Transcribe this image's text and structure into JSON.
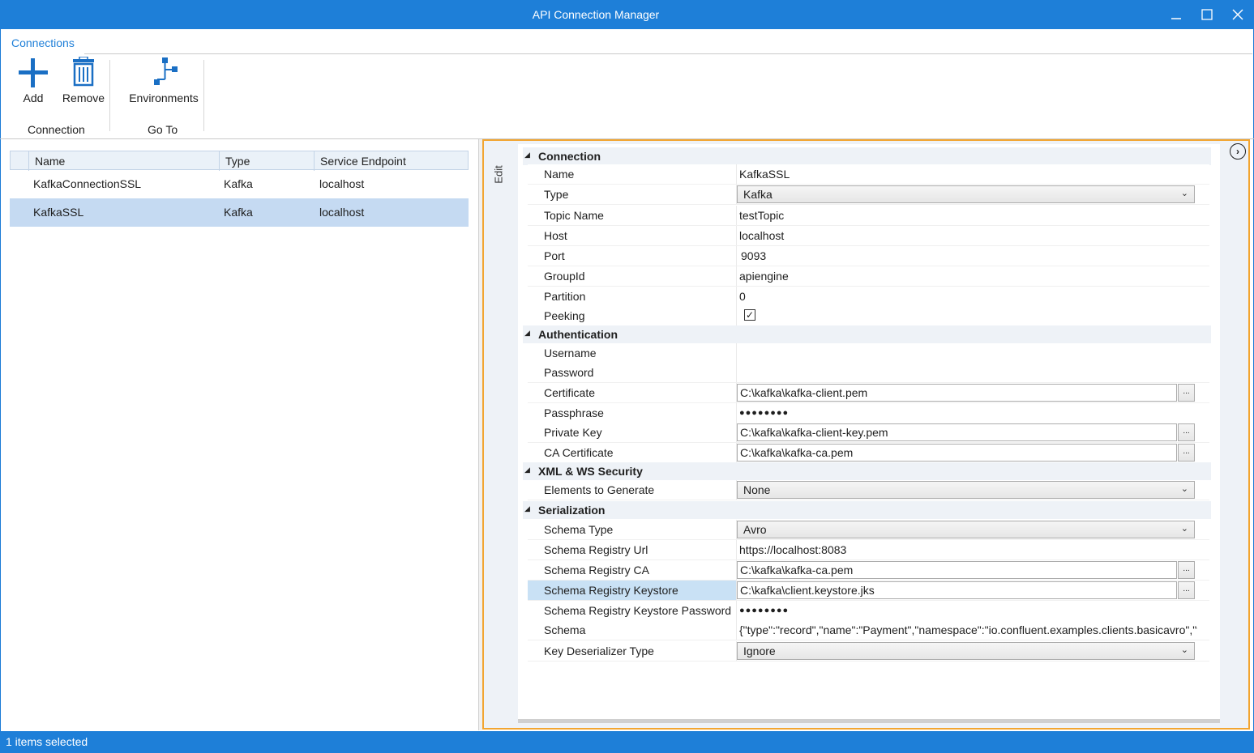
{
  "window": {
    "title": "API Connection Manager",
    "controls": {
      "minimize": "–",
      "maximize": "☐",
      "close": "✕"
    }
  },
  "ribbon": {
    "tab": "Connections",
    "groups": [
      {
        "label": "Connection",
        "buttons": [
          {
            "label": "Add",
            "icon": "plus-icon"
          },
          {
            "label": "Remove",
            "icon": "trash-icon"
          }
        ]
      },
      {
        "label": "Go To",
        "buttons": [
          {
            "label": "Environments",
            "icon": "environments-icon"
          }
        ]
      }
    ]
  },
  "grid": {
    "columns": [
      "Name",
      "Type",
      "Service Endpoint"
    ],
    "rows": [
      {
        "name": "KafkaConnectionSSL",
        "type": "Kafka",
        "endpoint": "localhost",
        "selected": false
      },
      {
        "name": "KafkaSSL",
        "type": "Kafka",
        "endpoint": "localhost",
        "selected": true
      }
    ]
  },
  "panel": {
    "edit_tab": "Edit",
    "categories": {
      "connection": "Connection",
      "authentication": "Authentication",
      "xml_ws": "XML & WS Security",
      "serialization": "Serialization"
    },
    "props": {
      "name": {
        "label": "Name",
        "value": "KafkaSSL"
      },
      "type": {
        "label": "Type",
        "value": "Kafka"
      },
      "topic": {
        "label": "Topic Name",
        "value": "testTopic"
      },
      "host": {
        "label": "Host",
        "value": "localhost"
      },
      "port": {
        "label": "Port",
        "value": "9093"
      },
      "groupid": {
        "label": "GroupId",
        "value": "apiengine"
      },
      "partition": {
        "label": "Partition",
        "value": "0"
      },
      "peeking": {
        "label": "Peeking",
        "value": "✓"
      },
      "username": {
        "label": "Username",
        "value": ""
      },
      "password": {
        "label": "Password",
        "value": ""
      },
      "certificate": {
        "label": "Certificate",
        "value": "C:\\kafka\\kafka-client.pem"
      },
      "passphrase": {
        "label": "Passphrase",
        "value": "●●●●●●●●"
      },
      "privatekey": {
        "label": "Private Key",
        "value": "C:\\kafka\\kafka-client-key.pem"
      },
      "cacert": {
        "label": "CA Certificate",
        "value": "C:\\kafka\\kafka-ca.pem"
      },
      "elements": {
        "label": "Elements to Generate",
        "value": "None"
      },
      "schematype": {
        "label": "Schema Type",
        "value": "Avro"
      },
      "registryurl": {
        "label": "Schema Registry Url",
        "value": "https://localhost:8083"
      },
      "registryca": {
        "label": "Schema Registry CA",
        "value": "C:\\kafka\\kafka-ca.pem"
      },
      "registryks": {
        "label": "Schema Registry Keystore",
        "value": "C:\\kafka\\client.keystore.jks"
      },
      "registrykspw": {
        "label": "Schema Registry Keystore Password",
        "value": "●●●●●●●●"
      },
      "schema": {
        "label": "Schema",
        "value": "{\"type\":\"record\",\"name\":\"Payment\",\"namespace\":\"io.confluent.examples.clients.basicavro\",\"f"
      },
      "keydeser": {
        "label": "Key Deserializer Type",
        "value": "Ignore"
      }
    },
    "dots_label": "...",
    "expand_icon": "chevron-right-circle-icon"
  },
  "status": {
    "text": "1 items selected"
  },
  "colors": {
    "accent": "#1e7fd8",
    "panel_border": "#f2a531",
    "selection": "#c5daf2"
  }
}
